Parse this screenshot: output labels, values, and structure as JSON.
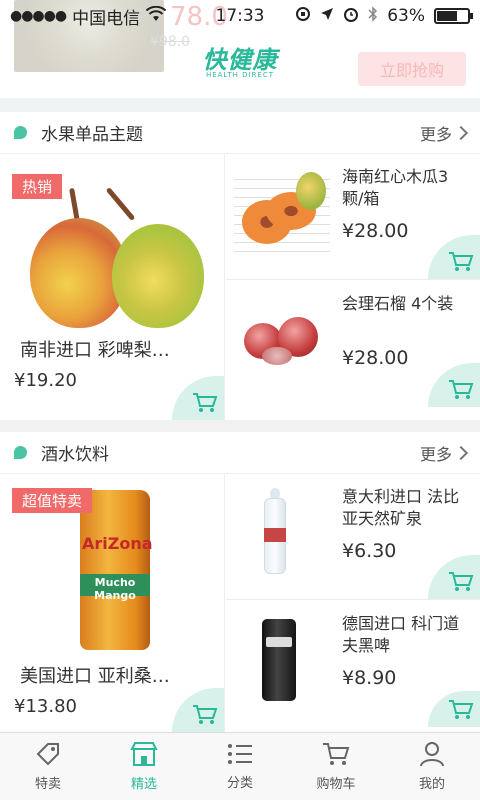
{
  "status_bar": {
    "carrier": "中国电信",
    "time": "17:33",
    "battery": "63%"
  },
  "header": {
    "logo_main": "快健康",
    "logo_sub": "HEALTH DIRECT",
    "promo_price": "78.0",
    "promo_old_price": "¥98.0",
    "promo_button": "立即抢购"
  },
  "sections": [
    {
      "title": "水果单品主题",
      "more": "更多",
      "big": {
        "badge": "热销",
        "name": "南非进口 彩啤梨…",
        "price": "¥19.20"
      },
      "small": [
        {
          "name": "海南红心木瓜3颗/箱",
          "price": "¥28.00"
        },
        {
          "name": "会理石榴 4个装",
          "price": "¥28.00"
        }
      ]
    },
    {
      "title": "酒水饮料",
      "more": "更多",
      "big": {
        "badge": "超值特卖",
        "name": "美国进口 亚利桑…",
        "price": "¥13.80",
        "can_brand": "AriZona",
        "can_flavor": "Mucho Mango"
      },
      "small": [
        {
          "name": "意大利进口 法比亚天然矿泉",
          "price": "¥6.30"
        },
        {
          "name": "德国进口 科门道夫黑啤",
          "price": "¥8.90"
        }
      ]
    }
  ],
  "nav": [
    {
      "label": "特卖",
      "icon": "tag-icon"
    },
    {
      "label": "精选",
      "icon": "store-icon"
    },
    {
      "label": "分类",
      "icon": "list-icon"
    },
    {
      "label": "购物车",
      "icon": "cart-icon"
    },
    {
      "label": "我的",
      "icon": "user-icon"
    }
  ],
  "colors": {
    "accent": "#29b89a",
    "badge": "#f06a6a",
    "cart_bg": "#d8f1ea"
  }
}
